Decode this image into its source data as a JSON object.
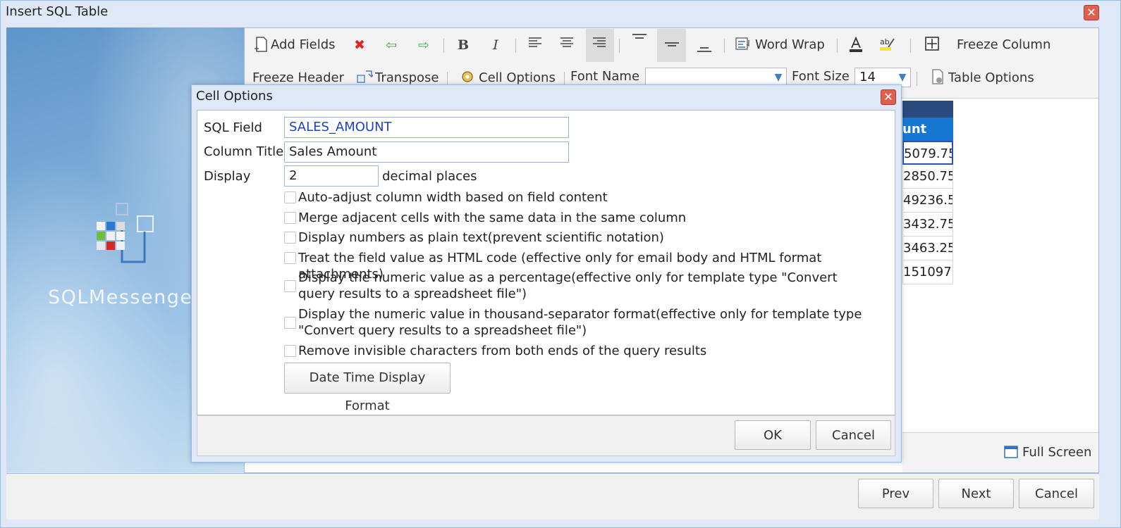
{
  "window": {
    "title": "Insert SQL Table",
    "close_glyph": "✕"
  },
  "splash": {
    "brand": "SQLMessenger"
  },
  "toolbar": {
    "add_fields": "Add Fields",
    "word_wrap": "Word Wrap",
    "freeze_column": "Freeze Column",
    "freeze_header": "Freeze Header",
    "transpose": "Transpose",
    "cell_options": "Cell Options",
    "font_name_label": "Font Name",
    "font_name_value": "",
    "font_size_label": "Font Size",
    "font_size_value": "14",
    "table_options": "Table Options"
  },
  "table": {
    "header": "unt",
    "cells": [
      "5079.75",
      "2850.75",
      "49236.5",
      "3432.75",
      "3463.25",
      "151097"
    ]
  },
  "status": {
    "full_screen": "Full Screen"
  },
  "footer": {
    "prev": "Prev",
    "next": "Next",
    "cancel": "Cancel"
  },
  "dialog": {
    "title": "Cell Options",
    "sql_field_label": "SQL Field",
    "sql_field_value": "SALES_AMOUNT",
    "column_title_label": "Column Title",
    "column_title_value": "Sales Amount",
    "display_label": "Display",
    "decimal_value": "2",
    "decimal_suffix": "decimal places",
    "options": [
      "Auto-adjust column width based on field content",
      "Merge adjacent cells with the same data in the same column",
      "Display numbers as plain text(prevent scientific notation)",
      "Treat the field value as HTML code (effective only for email body and HTML format attachments)",
      "Display the numeric value as a percentage(effective only for template type \"Convert query results to a spreadsheet file\")",
      "Display the numeric value in thousand-separator format(effective only for template type \"Convert query results to a spreadsheet file\")",
      "Remove invisible characters from both ends of the query results"
    ],
    "date_time_button": "Date Time Display Format",
    "ok": "OK",
    "cancel": "Cancel"
  },
  "colors": {
    "accent": "#1677d2",
    "sql_field_text": "#1a3fd6",
    "close": "#e06050"
  }
}
